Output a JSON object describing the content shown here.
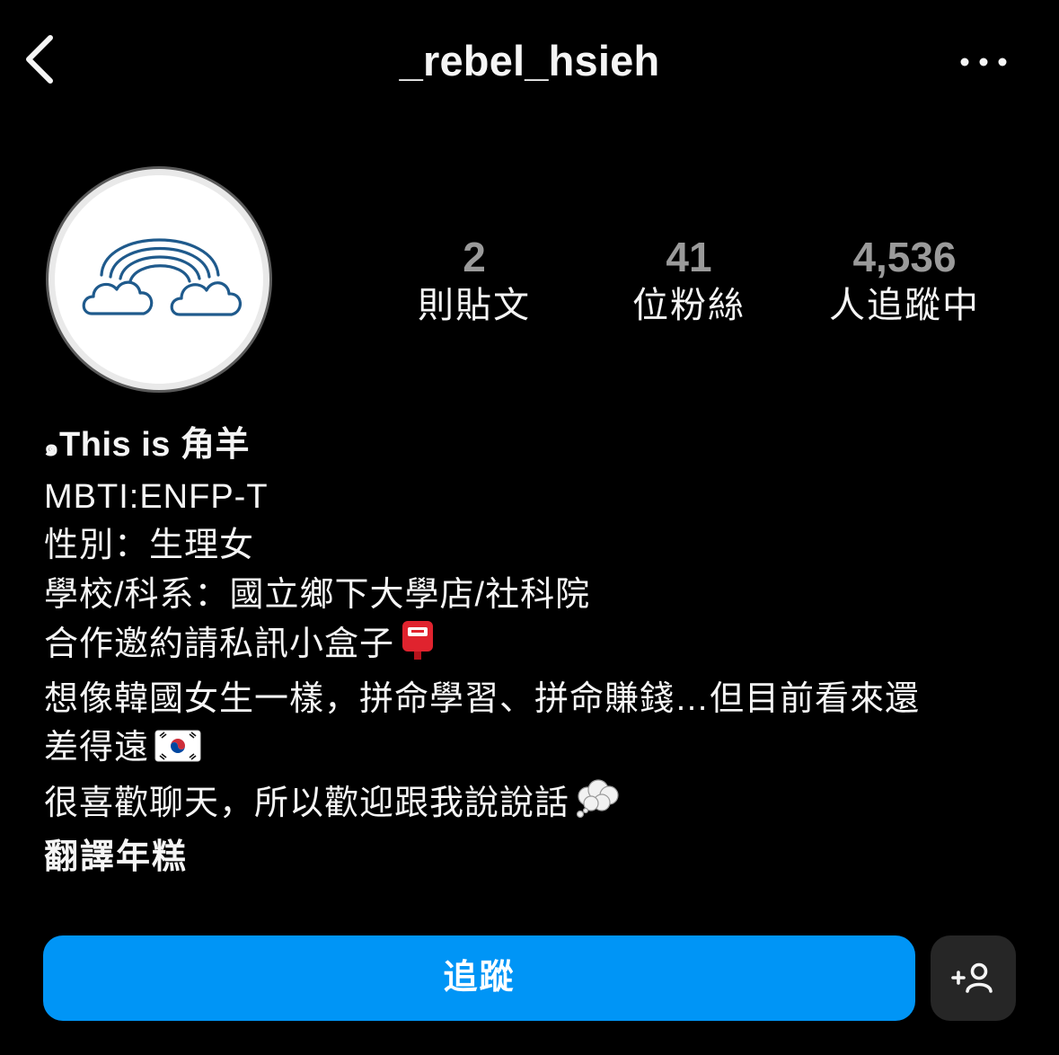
{
  "header": {
    "username": "_rebel_hsieh",
    "back_icon": "chevron-left-icon",
    "more_icon": "more-horizontal-icon"
  },
  "profile": {
    "avatar_icon": "rainbow-clouds-icon",
    "stats": [
      {
        "value": "2",
        "label": "則貼文"
      },
      {
        "value": "41",
        "label": "位粉絲"
      },
      {
        "value": "4,536",
        "label": "人追蹤中"
      }
    ]
  },
  "bio": {
    "name_prefix": "๑",
    "name": "This is 角羊",
    "lines": [
      "MBTI:ENFP-T",
      "性別：生理女",
      "學校/科系：國立鄉下大學店/社科院",
      "合作邀約請私訊小盒子",
      "想像韓國女生一樣，拼命學習、拼命賺錢…但目前看來還",
      "差得遠",
      "很喜歡聊天，所以歡迎跟我說說話"
    ],
    "emojis": {
      "mailbox": "postbox-icon",
      "flag": "south-korea-flag-icon",
      "bubble": "thought-balloon-icon"
    },
    "link_text": "翻譯年糕"
  },
  "actions": {
    "follow_label": "追蹤",
    "suggest_icon": "add-person-icon"
  },
  "colors": {
    "background": "#000000",
    "accent": "#0095f6",
    "secondary_button": "#262626",
    "stat_number": "#9a9a9a"
  }
}
